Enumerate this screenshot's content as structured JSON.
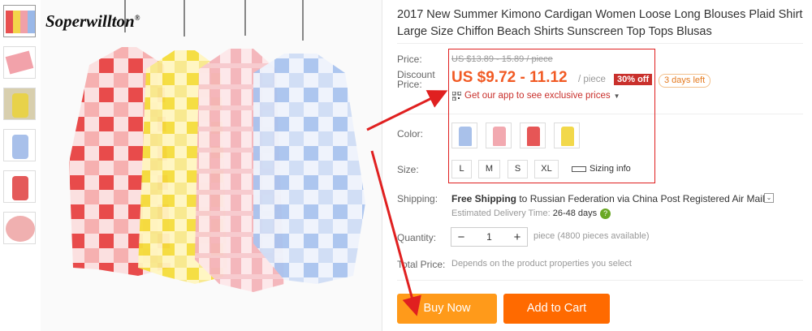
{
  "brand": {
    "name": "Soperwillton",
    "mark": "®"
  },
  "product": {
    "title": "2017 New Summer Kimono Cardigan Women Loose Long Blouses Plaid Shirt Large Size Chiffon Beach Shirts Sunscreen Top Tops Blusas"
  },
  "thumbnails": [
    {
      "name": "thumb-all-colors",
      "colors": [
        "#e85050",
        "#f3d54a",
        "#f0a0a8",
        "#9ab8e8"
      ]
    },
    {
      "name": "thumb-pink-folded",
      "colors": [
        "#f2a2aa",
        "#f7c8cc"
      ]
    },
    {
      "name": "thumb-yellow-model",
      "colors": [
        "#e8d24a",
        "#c9b23c"
      ]
    },
    {
      "name": "thumb-blue",
      "colors": [
        "#a8c0ea",
        "#c9d8f2"
      ]
    },
    {
      "name": "thumb-red",
      "colors": [
        "#e45a5a",
        "#f2b0b0"
      ]
    },
    {
      "name": "thumb-pink-detail",
      "colors": [
        "#e87878",
        "#f5c5c5"
      ]
    }
  ],
  "pricing": {
    "price_label": "Price:",
    "original_price": "US $13.89 - 15.89 / piece",
    "discount_label_line1": "Discount",
    "discount_label_line2": "Price:",
    "discount_price": "US $9.72 - 11.12",
    "per_piece": "/ piece",
    "off_badge": "30% off",
    "days_left": "3 days left",
    "app_promo": "Get our app to see exclusive prices",
    "accent": "#f15a24"
  },
  "color": {
    "label": "Color:",
    "options": [
      {
        "name": "blue",
        "fill": "#a9c1ea"
      },
      {
        "name": "pink",
        "fill": "#f2a9b0"
      },
      {
        "name": "red",
        "fill": "#e65656"
      },
      {
        "name": "yellow",
        "fill": "#f2d84a"
      }
    ]
  },
  "size": {
    "label": "Size:",
    "options": [
      "L",
      "M",
      "S",
      "XL"
    ],
    "sizing_info": "Sizing info"
  },
  "shipping": {
    "label": "Shipping:",
    "free_text": "Free Shipping",
    "dest_text": " to Russian Federation via China Post Registered Air Mail",
    "dropdown_icon": "chevron-down-icon",
    "estimated_label": "Estimated Delivery Time: ",
    "estimated_value": "26-48 days"
  },
  "quantity": {
    "label": "Quantity:",
    "value": "1",
    "minus": "−",
    "plus": "+",
    "available": "piece (4800 pieces available)"
  },
  "total": {
    "label": "Total Price:",
    "note": "Depends on the product properties you select"
  },
  "actions": {
    "buy_now": "Buy Now",
    "add_to_cart": "Add to Cart",
    "buy_color": "#ff9a1a",
    "cart_color": "#ff6a00"
  },
  "annotation": {
    "color": "#e02020"
  }
}
